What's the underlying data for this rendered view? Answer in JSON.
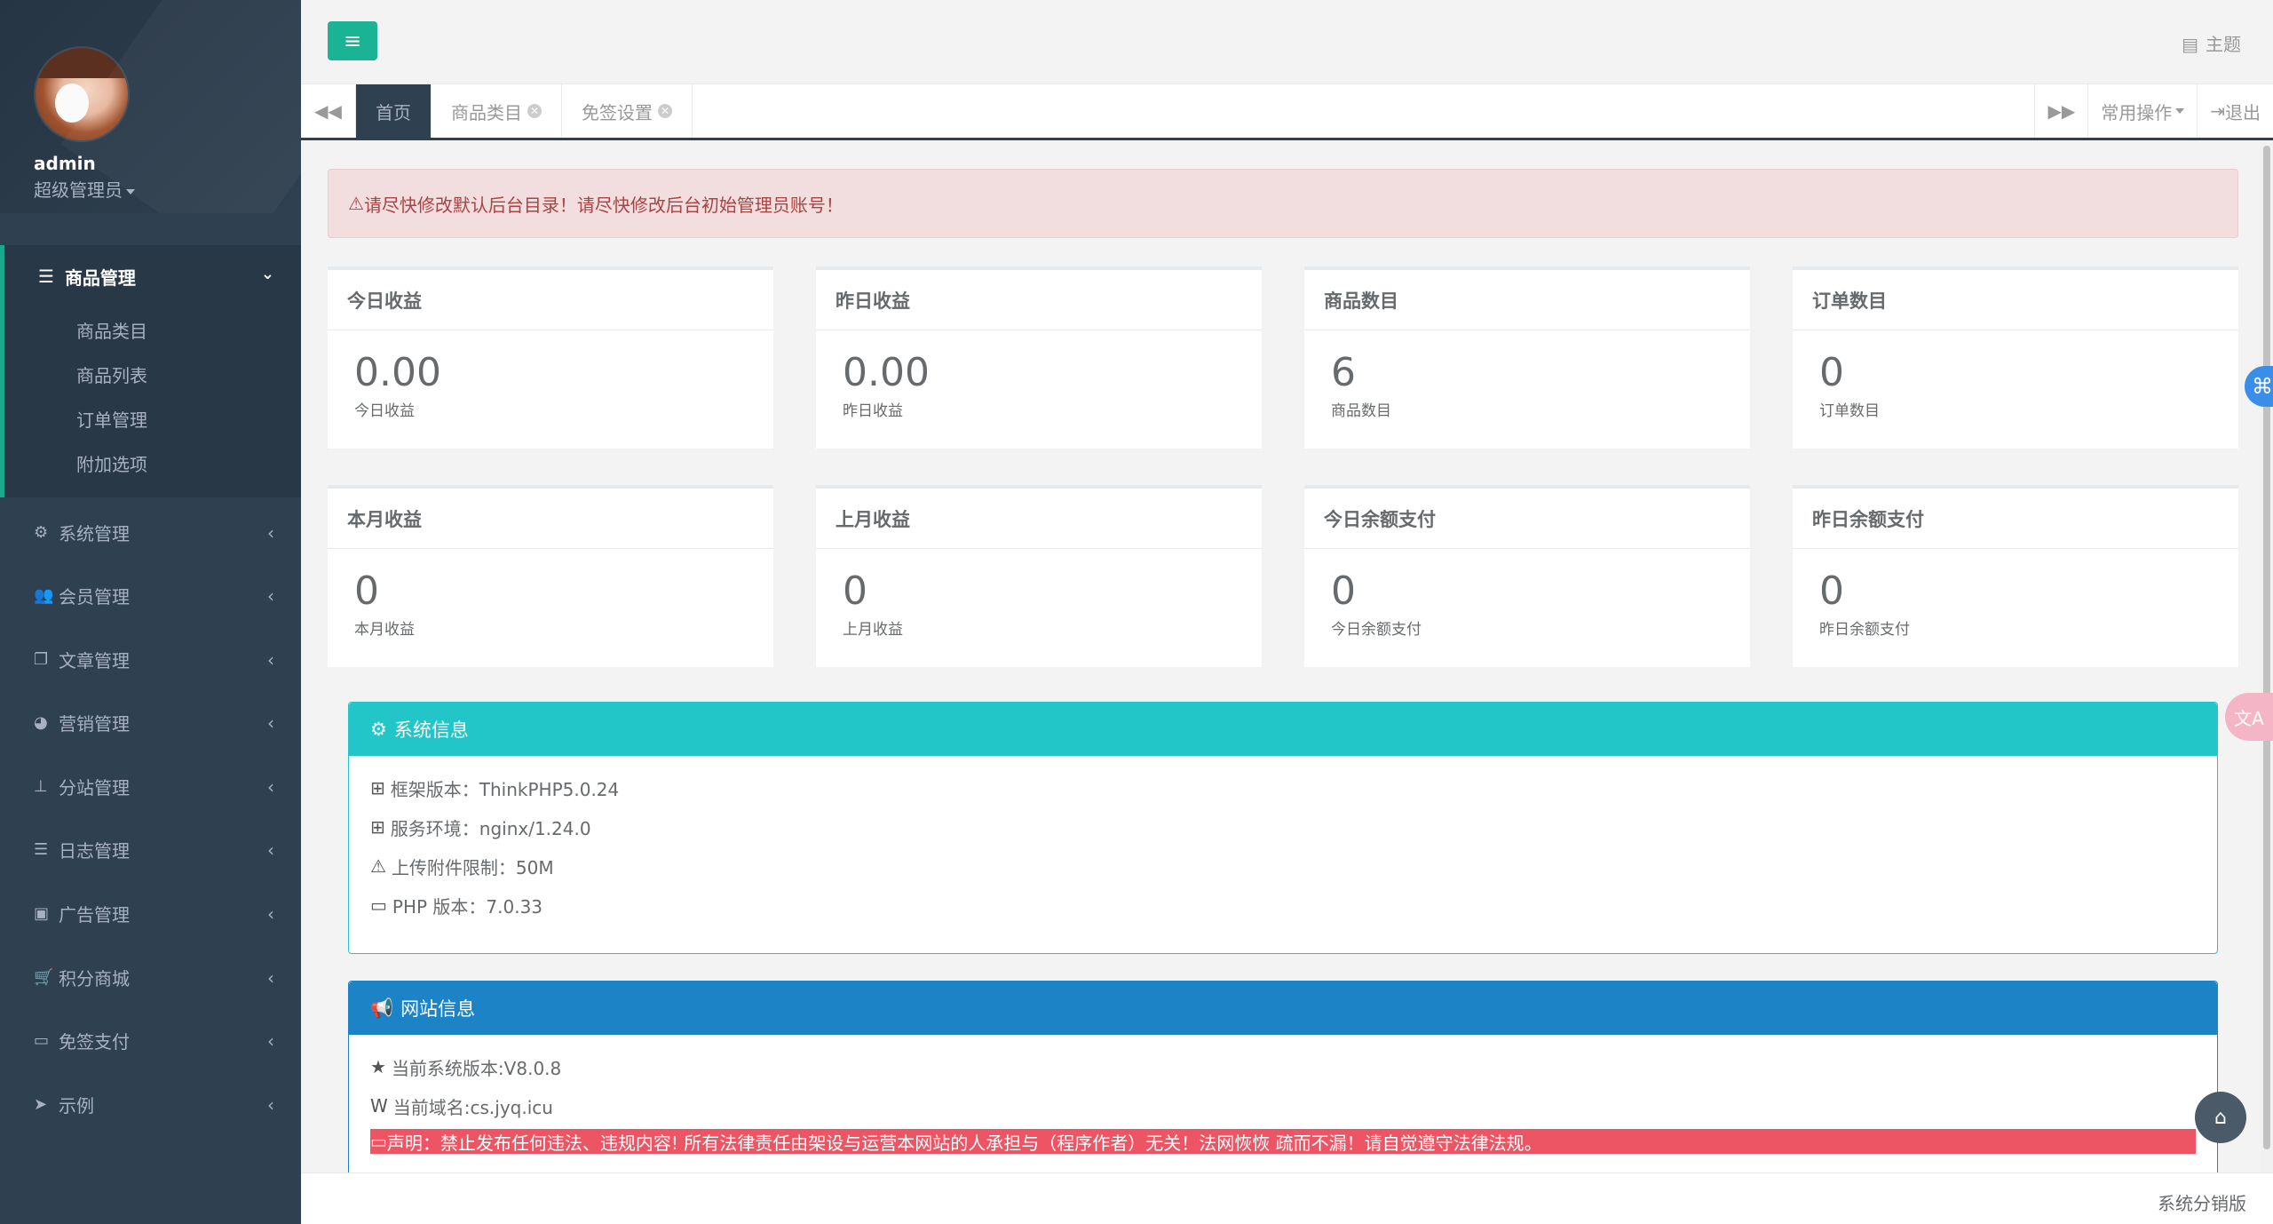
{
  "sidebar": {
    "username": "admin",
    "role": "超级管理员",
    "active_group": {
      "label": "商品管理",
      "icon": "bars-icon",
      "items": [
        "商品类目",
        "商品列表",
        "订单管理",
        "附加选项"
      ]
    },
    "items": [
      {
        "label": "系统管理",
        "icon": "gear-icon"
      },
      {
        "label": "会员管理",
        "icon": "users-icon"
      },
      {
        "label": "文章管理",
        "icon": "copy-icon"
      },
      {
        "label": "营销管理",
        "icon": "pie-chart-icon"
      },
      {
        "label": "分站管理",
        "icon": "thumbtack-icon"
      },
      {
        "label": "日志管理",
        "icon": "list-icon"
      },
      {
        "label": "广告管理",
        "icon": "image-icon"
      },
      {
        "label": "积分商城",
        "icon": "cart-icon"
      },
      {
        "label": "免签支付",
        "icon": "credit-card-icon"
      },
      {
        "label": "示例",
        "icon": "paper-plane-icon"
      }
    ]
  },
  "header": {
    "theme_label": "主题"
  },
  "tabs": {
    "items": [
      {
        "label": "首页",
        "active": true,
        "closable": false
      },
      {
        "label": "商品类目",
        "active": false,
        "closable": true
      },
      {
        "label": "免签设置",
        "active": false,
        "closable": true
      }
    ],
    "common_ops": "常用操作",
    "logout": "退出"
  },
  "alert": {
    "text": "请尽快修改默认后台目录！请尽快修改后台初始管理员账号！"
  },
  "stats": [
    {
      "title": "今日收益",
      "value": "0.00",
      "label": "今日收益"
    },
    {
      "title": "昨日收益",
      "value": "0.00",
      "label": "昨日收益"
    },
    {
      "title": "商品数目",
      "value": "6",
      "label": "商品数目"
    },
    {
      "title": "订单数目",
      "value": "0",
      "label": "订单数目"
    },
    {
      "title": "本月收益",
      "value": "0",
      "label": "本月收益"
    },
    {
      "title": "上月收益",
      "value": "0",
      "label": "上月收益"
    },
    {
      "title": "今日余额支付",
      "value": "0",
      "label": "今日余额支付"
    },
    {
      "title": "昨日余额支付",
      "value": "0",
      "label": "昨日余额支付"
    }
  ],
  "system_info": {
    "title": "系统信息",
    "rows": [
      {
        "icon": "sitemap-icon",
        "text": "框架版本：ThinkPHP5.0.24"
      },
      {
        "icon": "windows-icon",
        "text": "服务环境：nginx/1.24.0"
      },
      {
        "icon": "warning-icon",
        "text": "上传附件限制：50M"
      },
      {
        "icon": "credit-card-icon",
        "text": "PHP 版本：7.0.33"
      }
    ]
  },
  "site_info": {
    "title": "网站信息",
    "rows": [
      {
        "icon": "star-icon",
        "text": "当前系统版本:V8.0.8"
      },
      {
        "icon": "wikipedia-icon",
        "text": "当前域名:cs.jyq.icu"
      }
    ],
    "disclaimer": "声明：禁止发布任何违法、违规内容! 所有法律责任由架设与运营本网站的人承担与（程序作者）无关！法网恢恢 疏而不漏！请自觉遵守法律法规。"
  },
  "footer": {
    "text": "系统分销版"
  },
  "colors": {
    "sidebar": "#2f4050",
    "accent": "#1ab394",
    "cyan": "#23c6c8",
    "blue": "#1c84c6",
    "red": "#ed5565"
  }
}
